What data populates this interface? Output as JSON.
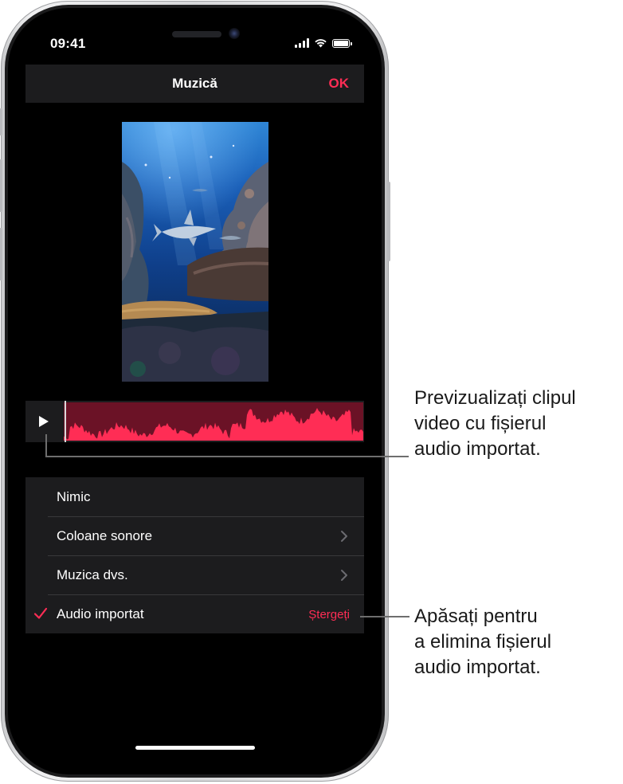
{
  "status_bar": {
    "time": "09:41",
    "icons": [
      "signal-icon",
      "wifi-icon",
      "battery-icon"
    ]
  },
  "navbar": {
    "title": "Muzică",
    "ok_label": "OK"
  },
  "player": {
    "play_icon": "play-icon",
    "waveform_color": "#ff2d55"
  },
  "list": {
    "items": [
      {
        "label": "Nimic",
        "checked": false,
        "chevron": false
      },
      {
        "label": "Coloane sonore",
        "checked": false,
        "chevron": true
      },
      {
        "label": "Muzica dvs.",
        "checked": false,
        "chevron": true
      },
      {
        "label": "Audio importat",
        "checked": true,
        "chevron": false,
        "action": "Ștergeți"
      }
    ]
  },
  "callouts": {
    "preview": {
      "lines": [
        "Previzualizați clipul",
        "video cu fișierul",
        "audio importat."
      ]
    },
    "delete": {
      "lines": [
        "Apăsați pentru",
        "a elimina fișierul",
        "audio importat."
      ]
    }
  },
  "colors": {
    "accent": "#ff2d55",
    "background": "#000000",
    "row_bg": "#1c1c1e"
  }
}
